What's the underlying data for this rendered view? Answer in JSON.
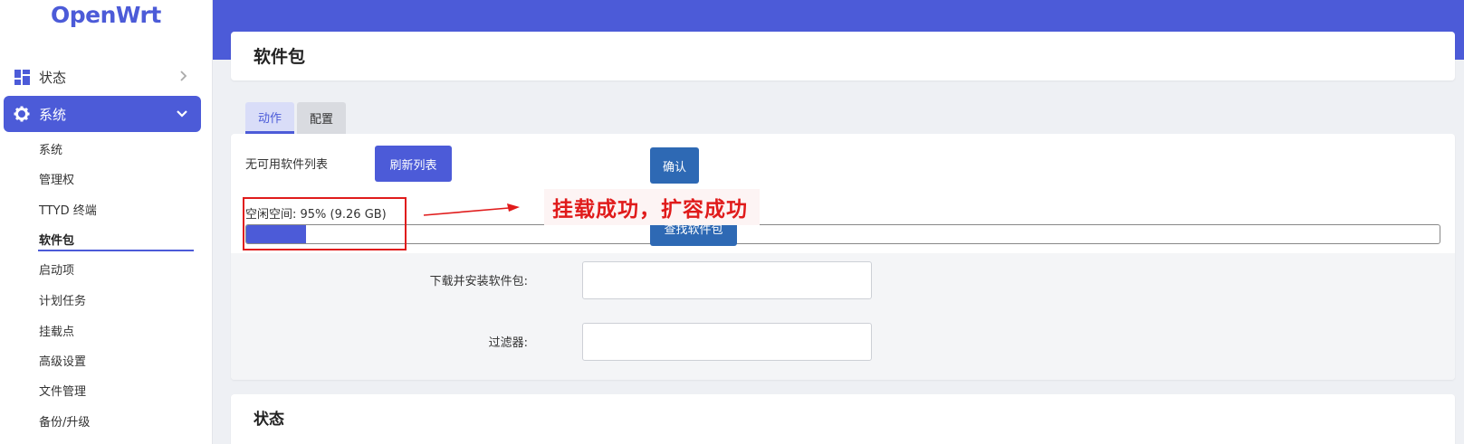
{
  "sidebar": {
    "logo": "OpenWrt",
    "status_label": "状态",
    "system_label": "系统",
    "sub_items": [
      "系统",
      "管理权",
      "TTYD 终端",
      "软件包",
      "启动项",
      "计划任务",
      "挂载点",
      "高级设置",
      "文件管理",
      "备份/升级"
    ],
    "active_sub_item": "软件包"
  },
  "page": {
    "title": "软件包",
    "tabs": [
      "动作",
      "配置"
    ],
    "active_tab": "动作"
  },
  "actions": {
    "no_list_text": "无可用软件列表",
    "refresh_button": "刷新列表",
    "free_space_label": "空闲空间: 95% (9.26 GB)",
    "free_space_fraction": 0.05,
    "install_label": "下载并安装软件包:",
    "install_value": "",
    "confirm_button": "确认",
    "filter_label": "过滤器:",
    "filter_value": "",
    "find_button": "查找软件包"
  },
  "annotation": {
    "text": "挂载成功，扩容成功",
    "color": "#e01b1b"
  },
  "status_section": {
    "title": "状态"
  },
  "colors": {
    "accent": "#4c5bd8",
    "button_blue": "#2e69b4"
  }
}
